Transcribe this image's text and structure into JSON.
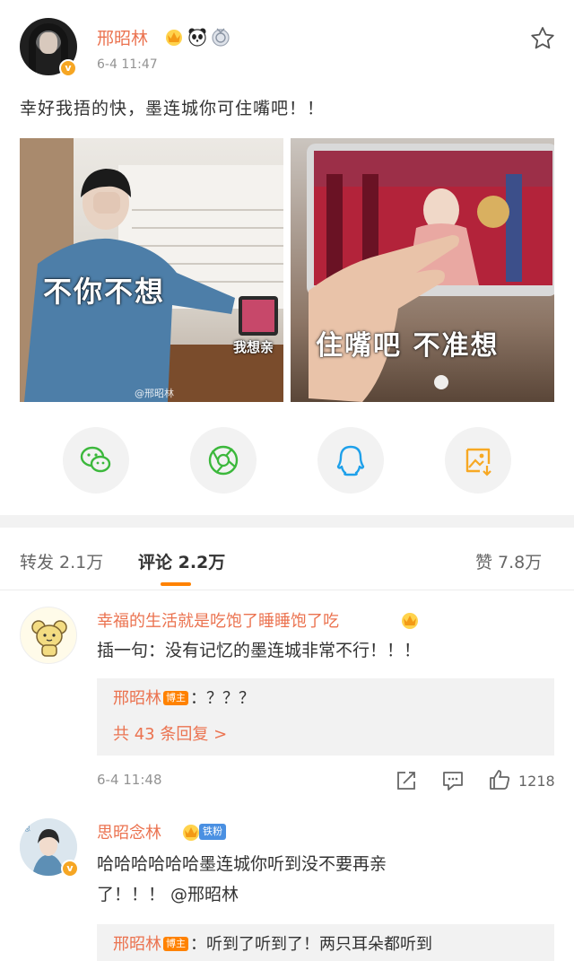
{
  "post": {
    "author": "邢昭林",
    "time": "6-4 11:47",
    "text": "幸好我捂的快，墨连城你可住嘴吧！！",
    "badges": [
      "crown-icon",
      "panda-icon",
      "medal-icon"
    ],
    "verified_icon": "v-badge-icon"
  },
  "images": [
    {
      "caption": "不你不想",
      "overlay": "我想亲",
      "watermark": "@邢昭林"
    },
    {
      "caption": "住嘴吧 不准想",
      "watermark": ""
    }
  ],
  "share": [
    {
      "icon": "wechat-icon"
    },
    {
      "icon": "moments-icon"
    },
    {
      "icon": "qq-icon"
    },
    {
      "icon": "save-image-icon"
    }
  ],
  "tabs": {
    "repost": "转发 2.1万",
    "comments": "评论 2.2万",
    "likes": "赞 7.8万"
  },
  "comments": [
    {
      "author": "幸福的生活就是吃饱了睡睡饱了吃",
      "text": "插一句：没有记忆的墨连城非常不行！！！",
      "reply_author": "邢昭林",
      "reply_tag": "博主",
      "reply_text": "：？？？",
      "more_replies": "共 43 条回复 >",
      "time": "6-4 11:48",
      "likes": "1218"
    },
    {
      "author": "思昭念林",
      "fan_tag": "铁粉",
      "text_line1": "哈哈哈哈哈哈墨连城你听到没不要再亲",
      "text_line2": "了！！！ @邢昭林",
      "reply_author": "邢昭林",
      "reply_tag": "博主",
      "reply_text": "：听到了听到了！两只耳朵都听到"
    }
  ],
  "colors": {
    "accent": "#eb7350",
    "orange": "#ff8200",
    "gray": "#939393"
  }
}
